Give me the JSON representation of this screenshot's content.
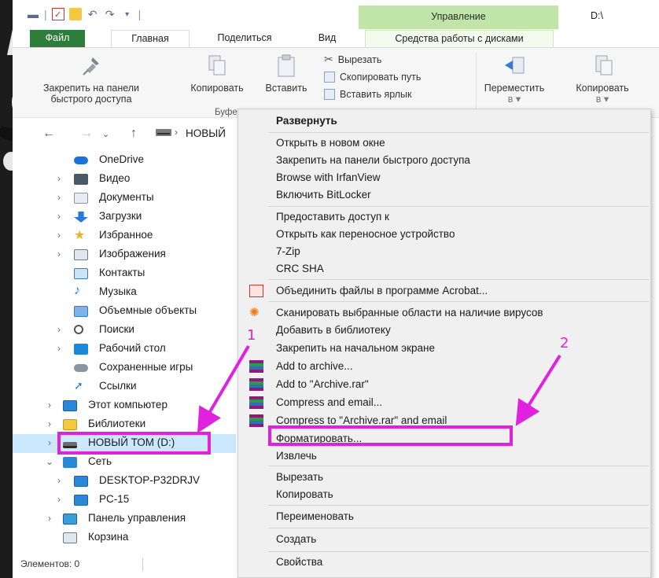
{
  "window": {
    "context_tab_group": "Управление",
    "title_path": "D:\\"
  },
  "ribbon_tabs": {
    "file": "Файл",
    "home": "Главная",
    "share": "Поделиться",
    "view": "Вид",
    "disk_tools": "Средства работы с дисками"
  },
  "ribbon": {
    "pin_line1": "Закрепить на панели",
    "pin_line2": "быстрого доступа",
    "copy": "Копировать",
    "paste": "Вставить",
    "cut": "Вырезать",
    "copy_path": "Скопировать путь",
    "paste_shortcut": "Вставить ярлык",
    "move_to_line1": "Переместить",
    "move_to_line2": "в",
    "copy_to_line1": "Копировать",
    "copy_to_line2": "в",
    "group_label": "Буфе"
  },
  "address": {
    "path": "НОВЫЙ"
  },
  "nav_pane": {
    "items": [
      {
        "label": "OneDrive"
      },
      {
        "label": "Видео"
      },
      {
        "label": "Документы"
      },
      {
        "label": "Загрузки"
      },
      {
        "label": "Избранное"
      },
      {
        "label": "Изображения"
      },
      {
        "label": "Контакты"
      },
      {
        "label": "Музыка"
      },
      {
        "label": "Объемные объекты"
      },
      {
        "label": "Поиски"
      },
      {
        "label": "Рабочий стол"
      },
      {
        "label": "Сохраненные игры"
      },
      {
        "label": "Ссылки"
      },
      {
        "label": "Этот компьютер"
      },
      {
        "label": "Библиотеки"
      },
      {
        "label": "НОВЫЙ ТОМ (D:)"
      },
      {
        "label": "Сеть"
      },
      {
        "label": "DESKTOP-P32DRJV"
      },
      {
        "label": "PC-15"
      },
      {
        "label": "Панель управления"
      },
      {
        "label": "Корзина"
      }
    ]
  },
  "status": {
    "items_count": "Элементов: 0"
  },
  "context_menu": {
    "items": [
      {
        "label": "Развернуть"
      },
      {
        "label": "Открыть в новом окне"
      },
      {
        "label": "Закрепить на панели быстрого доступа"
      },
      {
        "label": "Browse with IrfanView"
      },
      {
        "label": "Включить BitLocker"
      },
      {
        "label": "Предоставить доступ к"
      },
      {
        "label": "Открыть как переносное устройство"
      },
      {
        "label": "7-Zip"
      },
      {
        "label": "CRC SHA"
      },
      {
        "label": "Объединить файлы в программе Acrobat..."
      },
      {
        "label": "Сканировать выбранные области на наличие вирусов"
      },
      {
        "label": "Добавить в библиотеку"
      },
      {
        "label": "Закрепить на начальном экране"
      },
      {
        "label": "Add to archive..."
      },
      {
        "label": "Add to \"Archive.rar\""
      },
      {
        "label": "Compress and email..."
      },
      {
        "label": "Compress to \"Archive.rar\" and email"
      },
      {
        "label": "Форматировать..."
      },
      {
        "label": "Извлечь"
      },
      {
        "label": "Вырезать"
      },
      {
        "label": "Копировать"
      },
      {
        "label": "Переименовать"
      },
      {
        "label": "Создать"
      },
      {
        "label": "Свойства"
      }
    ]
  },
  "annotations": {
    "marker_1": "1",
    "marker_2": "2",
    "color": "#e021e0"
  },
  "colors": {
    "file_tab": "#2f7d3b",
    "context_tab": "#bfe6a8",
    "selection": "#cce8ff",
    "menu_bg": "#f0f0f0"
  }
}
